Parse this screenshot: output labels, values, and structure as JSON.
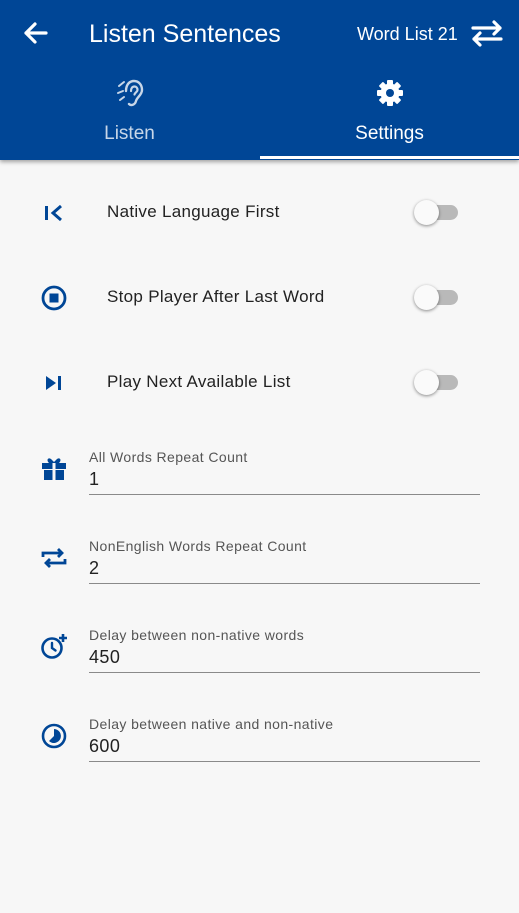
{
  "header": {
    "title": "Listen Sentences",
    "word_list": "Word List 21",
    "back_icon": "arrow-left-icon",
    "swap_icon": "swap-arrows-icon"
  },
  "tabs": [
    {
      "label": "Listen",
      "icon": "ear-icon",
      "active": false
    },
    {
      "label": "Settings",
      "icon": "gear-icon",
      "active": true
    }
  ],
  "toggles": [
    {
      "label": "Native Language First",
      "icon": "skip-to-start-icon",
      "on": false
    },
    {
      "label": "Stop Player After Last Word",
      "icon": "stop-circle-icon",
      "on": false
    },
    {
      "label": "Play Next Available List",
      "icon": "skip-next-icon",
      "on": false
    }
  ],
  "fields": [
    {
      "label": "All Words Repeat Count",
      "value": "1",
      "icon": "gift-icon"
    },
    {
      "label": "NonEnglish Words Repeat Count",
      "value": "2",
      "icon": "repeat-icon"
    },
    {
      "label": "Delay between non-native words",
      "value": "450",
      "icon": "clock-plus-icon"
    },
    {
      "label": "Delay between native and non-native",
      "value": "600",
      "icon": "timelapse-icon"
    }
  ],
  "colors": {
    "primary": "#004696",
    "background": "#f7f7f7",
    "text": "#222222"
  }
}
